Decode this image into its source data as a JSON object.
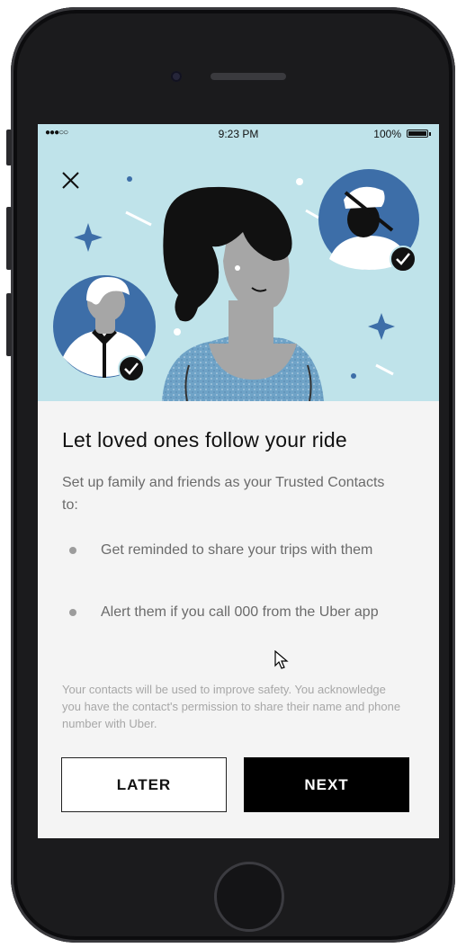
{
  "status_bar": {
    "signal": "●●●○○",
    "time": "9:23 PM",
    "battery": "100%"
  },
  "close_icon": "close-icon",
  "main": {
    "title": "Let loved ones follow your ride",
    "intro": "Set up family and friends as your Trusted Contacts to:",
    "bullets": [
      "Get reminded to share your trips with them",
      "Alert them if you call 000 from the Uber app"
    ],
    "disclaimer": "Your contacts will be used to improve safety. You acknowledge you have the contact's permission to share their name and phone number with Uber."
  },
  "buttons": {
    "later": "LATER",
    "next": "NEXT"
  },
  "colors": {
    "hero_background": "#bfe3ea",
    "primary_button": "#000000",
    "illustration_blue": "#3d6ea8"
  }
}
